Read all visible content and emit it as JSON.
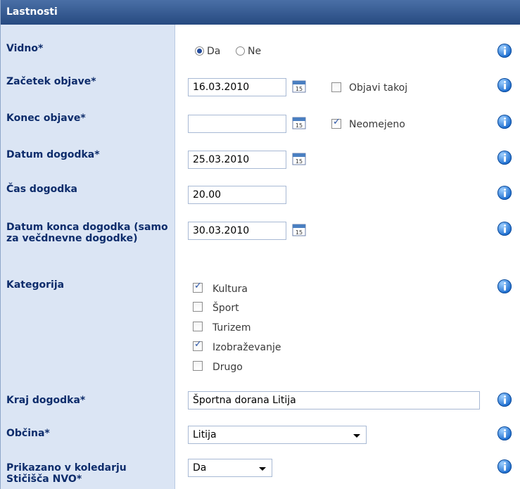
{
  "header": {
    "title": "Lastnosti"
  },
  "fields": {
    "vidno": {
      "label": "Vidno*",
      "opt_yes": "Da",
      "opt_no": "Ne"
    },
    "zacetek": {
      "label": "Začetek objave*",
      "value": "16.03.2010",
      "checkbox_label": "Objavi takoj"
    },
    "konec": {
      "label": "Konec objave*",
      "value": "",
      "checkbox_label": "Neomejeno"
    },
    "datum": {
      "label": "Datum dogodka*",
      "value": "25.03.2010"
    },
    "cas": {
      "label": "Čas dogodka",
      "value": "20.00"
    },
    "datum_konca": {
      "label": "Datum konca dogodka (samo za večdnevne dogodke)",
      "value": "30.03.2010"
    },
    "kategorija": {
      "label": "Kategorija",
      "options": [
        "Kultura",
        "Šport",
        "Turizem",
        "Izobraževanje",
        "Drugo"
      ]
    },
    "kraj": {
      "label": "Kraj dogodka*",
      "value": "Športna dorana Litija"
    },
    "obcina": {
      "label": "Občina*",
      "value": "Litija"
    },
    "prikazano": {
      "label": "Prikazano v koledarju Stičišča NVO*",
      "value": "Da"
    }
  },
  "calendar_day": "15"
}
